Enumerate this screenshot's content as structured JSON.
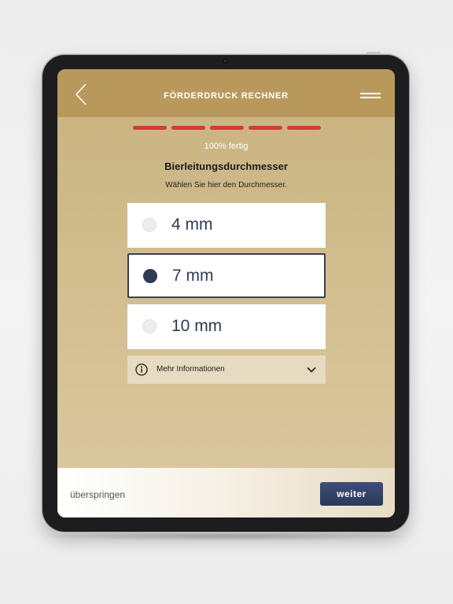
{
  "header": {
    "title": "FÖRDERDRUCK RECHNER",
    "back_icon": "chevron-left-icon",
    "menu_icon": "hamburger-menu-icon"
  },
  "progress": {
    "segments_total": 5,
    "segments_complete": 5,
    "percent": 100,
    "label": "100% fertig",
    "color": "#d33a3b"
  },
  "question": {
    "title": "Bierleitungsdurchmesser",
    "subtitle": "Wählen Sie hier den Durchmesser."
  },
  "options": [
    {
      "label": "4 mm",
      "selected": false
    },
    {
      "label": "7 mm",
      "selected": true
    },
    {
      "label": "10 mm",
      "selected": false
    }
  ],
  "info": {
    "label": "Mehr Informationen",
    "icon": "info-icon",
    "toggle_icon": "chevron-down-icon"
  },
  "footer": {
    "skip_label": "überspringen",
    "next_label": "weiter"
  },
  "colors": {
    "header_bg": "#b9995b",
    "accent_navy": "#2f3a52",
    "progress_red": "#d33a3b"
  }
}
